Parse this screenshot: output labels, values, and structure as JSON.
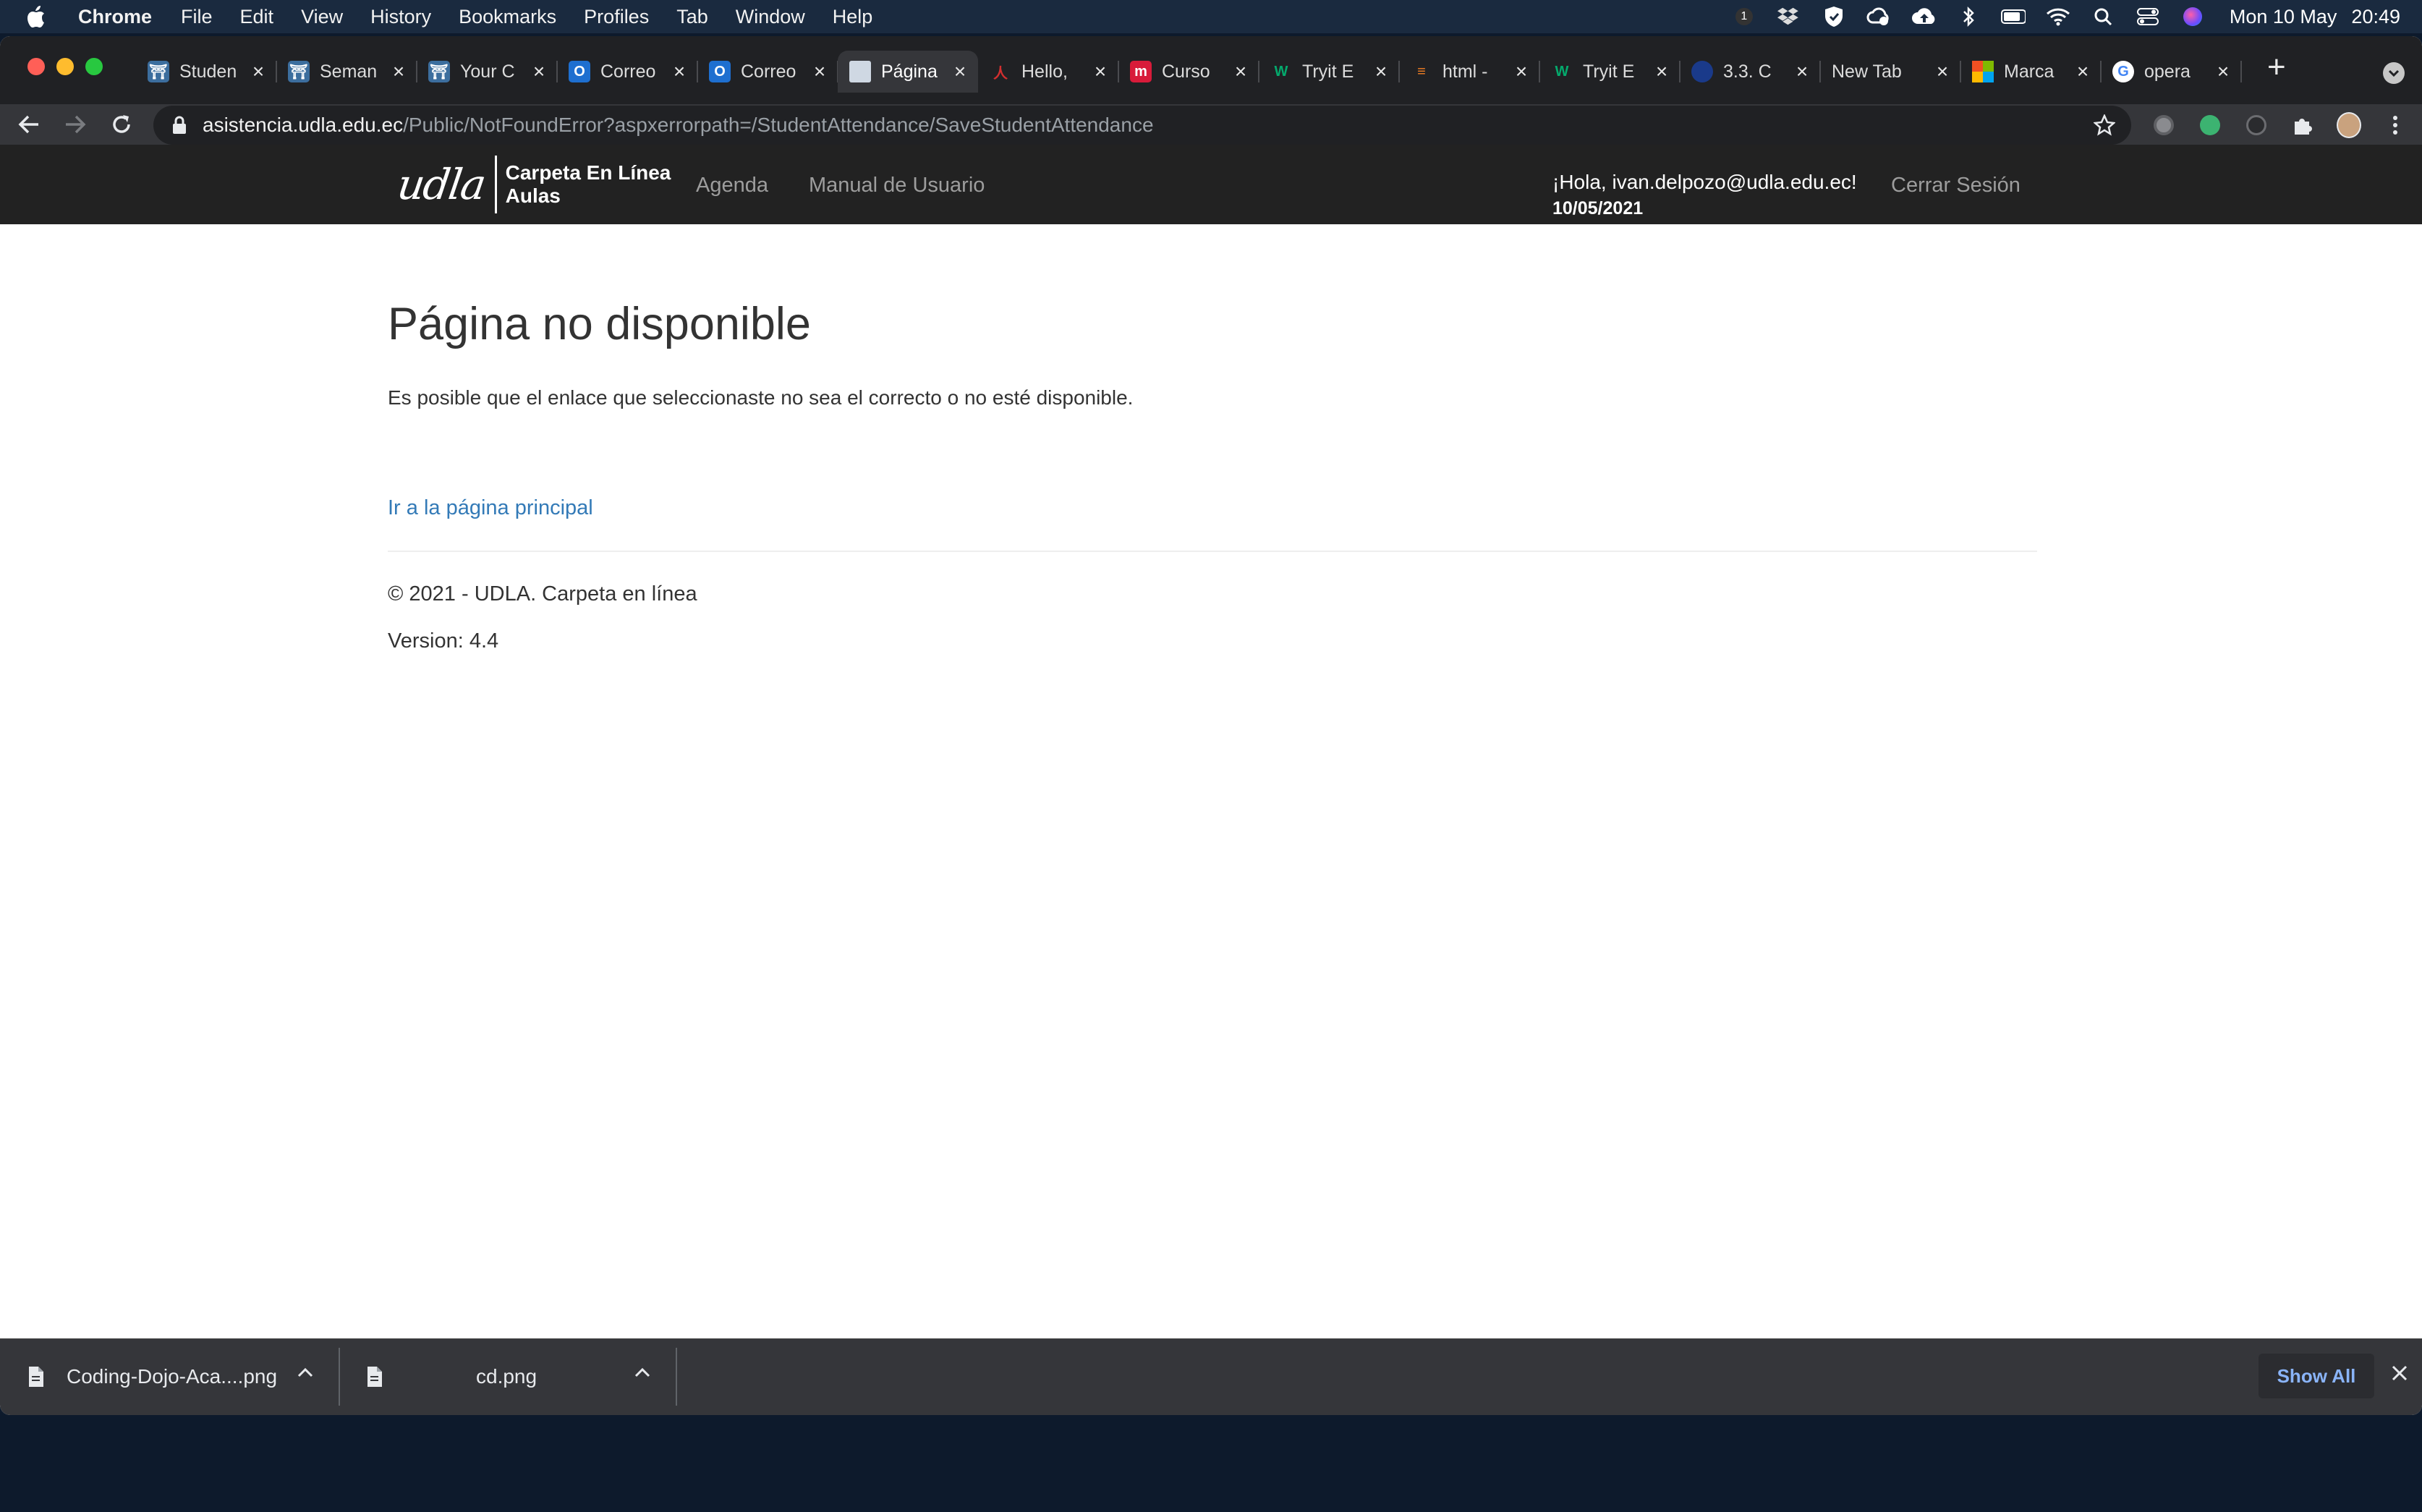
{
  "menubar": {
    "app": "Chrome",
    "items": [
      "File",
      "Edit",
      "View",
      "History",
      "Bookmarks",
      "Profiles",
      "Tab",
      "Window",
      "Help"
    ],
    "notification_count": "1",
    "date": "Mon 10 May",
    "time": "20:49"
  },
  "tabs": [
    {
      "label": "Studen",
      "favicon": "udla-icon",
      "color": "#3c6e9e"
    },
    {
      "label": "Seman",
      "favicon": "udla-icon",
      "color": "#3c6e9e"
    },
    {
      "label": "Your C",
      "favicon": "udla-icon",
      "color": "#3c6e9e"
    },
    {
      "label": "Correo",
      "favicon": "outlook-icon",
      "color": "#1e6fd0"
    },
    {
      "label": "Correo",
      "favicon": "outlook-icon",
      "color": "#1e6fd0"
    },
    {
      "label": "Página",
      "favicon": "page-icon",
      "color": "#cfd8e3",
      "active": true
    },
    {
      "label": "Hello,",
      "favicon": "person-icon",
      "color": "#d32f2f"
    },
    {
      "label": "Curso",
      "favicon": "m-icon",
      "color": "#d81b3a"
    },
    {
      "label": "Tryit E",
      "favicon": "w3-icon",
      "color": "#04aa6d"
    },
    {
      "label": "html -",
      "favicon": "stackoverflow-icon",
      "color": "#f48024"
    },
    {
      "label": "Tryit E",
      "favicon": "w3-icon",
      "color": "#04aa6d"
    },
    {
      "label": "3.3. C",
      "favicon": "circle-icon",
      "color": "#1a3a8a"
    },
    {
      "label": "New Tab",
      "favicon": "none",
      "color": ""
    },
    {
      "label": "Marca",
      "favicon": "microsoft-icon",
      "color": "#f25022"
    },
    {
      "label": "opera",
      "favicon": "google-icon",
      "color": "#4285f4"
    }
  ],
  "omnibox": {
    "host": "asistencia.udla.edu.ec",
    "path": "/Public/NotFoundError?aspxerrorpath=/StudentAttendance/SaveStudentAttendance"
  },
  "site": {
    "logo_mark": "udla",
    "logo_line1": "Carpeta En Línea",
    "logo_line2": "Aulas",
    "nav_agenda": "Agenda",
    "nav_manual": "Manual de Usuario",
    "greeting": "¡Hola, ivan.delpozo@udla.edu.ec!",
    "date": "10/05/2021",
    "logout": "Cerrar Sesión"
  },
  "content": {
    "title": "Página no disponible",
    "message": "Es posible que el enlace que seleccionaste no sea el correcto o no esté disponible.",
    "home_link": "Ir a la página principal",
    "copyright": "© 2021 - UDLA. Carpeta en línea",
    "version": "Version: 4.4"
  },
  "downloads": {
    "items": [
      {
        "name": "Coding-Dojo-Aca....png"
      },
      {
        "name": "cd.png"
      }
    ],
    "show_all": "Show All"
  }
}
